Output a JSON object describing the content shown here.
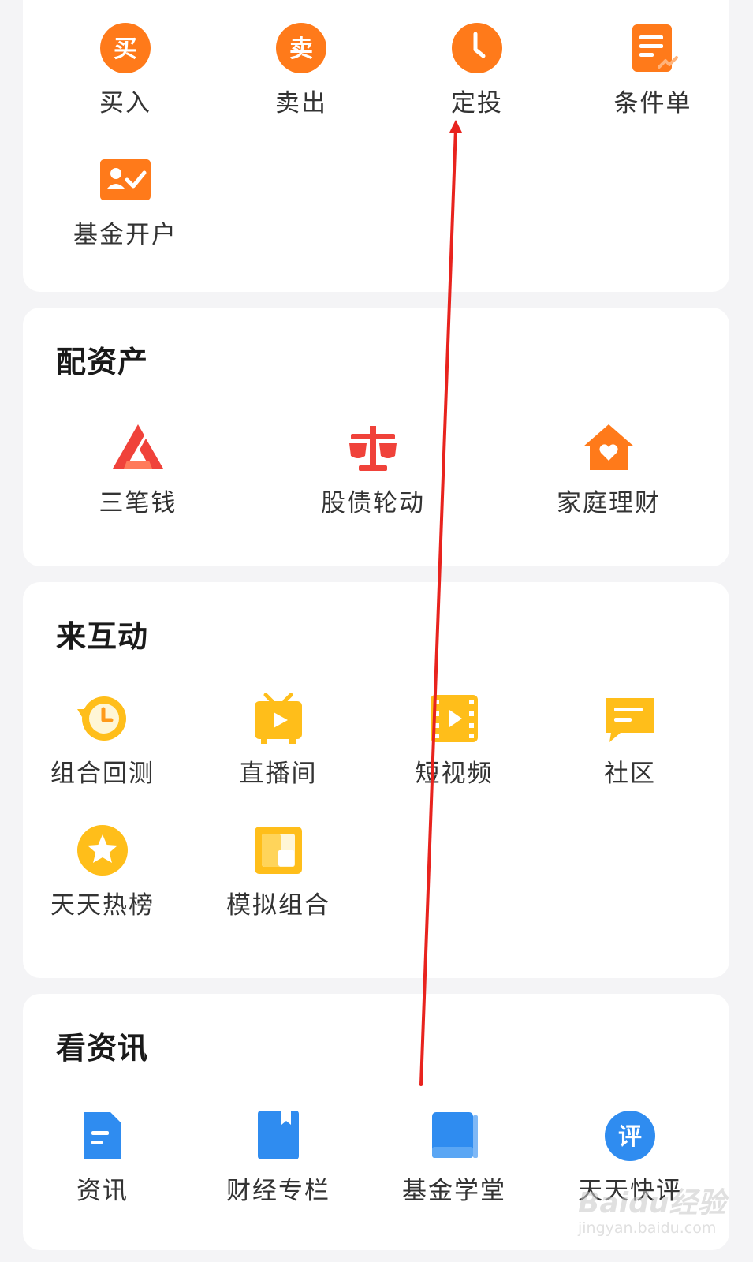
{
  "trade": {
    "items": [
      {
        "label": "买入",
        "glyph": "买",
        "icon": "buy-icon"
      },
      {
        "label": "卖出",
        "glyph": "卖",
        "icon": "sell-icon"
      },
      {
        "label": "定投",
        "icon": "clock-icon"
      },
      {
        "label": "条件单",
        "icon": "condition-order-icon"
      },
      {
        "label": "基金开户",
        "icon": "account-open-icon"
      }
    ]
  },
  "allocate": {
    "title": "配资产",
    "items": [
      {
        "label": "三笔钱",
        "icon": "triangle-logo-icon"
      },
      {
        "label": "股债轮动",
        "icon": "balance-scale-icon"
      },
      {
        "label": "家庭理财",
        "icon": "house-heart-icon"
      }
    ]
  },
  "interact": {
    "title": "来互动",
    "items": [
      {
        "label": "组合回测",
        "icon": "backtest-clock-icon"
      },
      {
        "label": "直播间",
        "icon": "live-tv-icon"
      },
      {
        "label": "短视频",
        "icon": "film-play-icon"
      },
      {
        "label": "社区",
        "icon": "chat-bubble-icon"
      },
      {
        "label": "天天热榜",
        "icon": "star-badge-icon"
      },
      {
        "label": "模拟组合",
        "icon": "portfolio-squares-icon"
      }
    ]
  },
  "news": {
    "title": "看资讯",
    "items": [
      {
        "label": "资讯",
        "icon": "document-icon"
      },
      {
        "label": "财经专栏",
        "icon": "bookmark-book-icon"
      },
      {
        "label": "基金学堂",
        "icon": "book-icon"
      },
      {
        "label": "天天快评",
        "glyph": "评",
        "icon": "review-icon"
      }
    ]
  },
  "watermark": {
    "main": "Baidu经验",
    "sub": "jingyan.baidu.com"
  },
  "colors": {
    "orange": "#ff7a1a",
    "orange_light": "#ff9a3c",
    "red": "#f0423a",
    "yellow": "#ffbe1a",
    "blue": "#2f8cf0",
    "arrow": "#e8231e"
  }
}
